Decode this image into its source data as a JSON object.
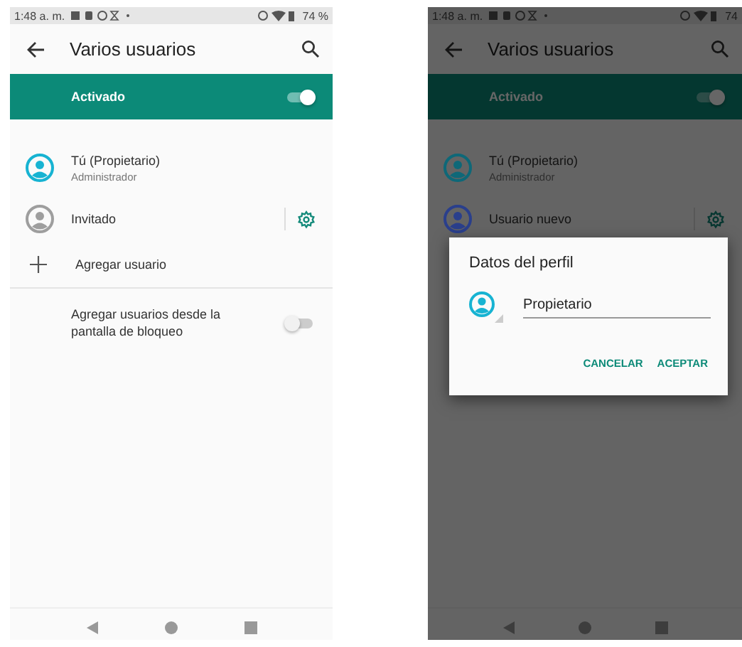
{
  "screens": [
    {
      "dimmed": false,
      "status_bar": {
        "time": "1:48 a. m.",
        "battery": "74 %"
      },
      "app_bar": {
        "title": "Varios usuarios"
      },
      "master_switch": {
        "label": "Activado",
        "on": true
      },
      "users": [
        {
          "name": "Tú (Propietario)",
          "subtitle": "Administrador",
          "color": "#17b3d2",
          "settings": false
        },
        {
          "name": "Invitado",
          "color": "#9e9e9e",
          "settings": true
        }
      ],
      "add_user": {
        "label": "Agregar usuario"
      },
      "lock_screen_option": {
        "label": "Agregar usuarios desde la pantalla de bloqueo",
        "on": false
      }
    },
    {
      "dimmed": true,
      "status_bar": {
        "time": "1:48 a. m.",
        "battery": "74"
      },
      "app_bar": {
        "title": "Varios usuarios"
      },
      "master_switch": {
        "label": "Activado",
        "on": true
      },
      "users": [
        {
          "name": "Tú (Propietario)",
          "subtitle": "Administrador",
          "color": "#0e6878",
          "settings": false
        },
        {
          "name": "Usuario nuevo",
          "color": "#2a3f8c",
          "settings": true
        }
      ],
      "dialog": {
        "title": "Datos del perfil",
        "name_value": "Propietario",
        "buttons": [
          "CANCELAR",
          "ACEPTAR"
        ]
      }
    }
  ]
}
